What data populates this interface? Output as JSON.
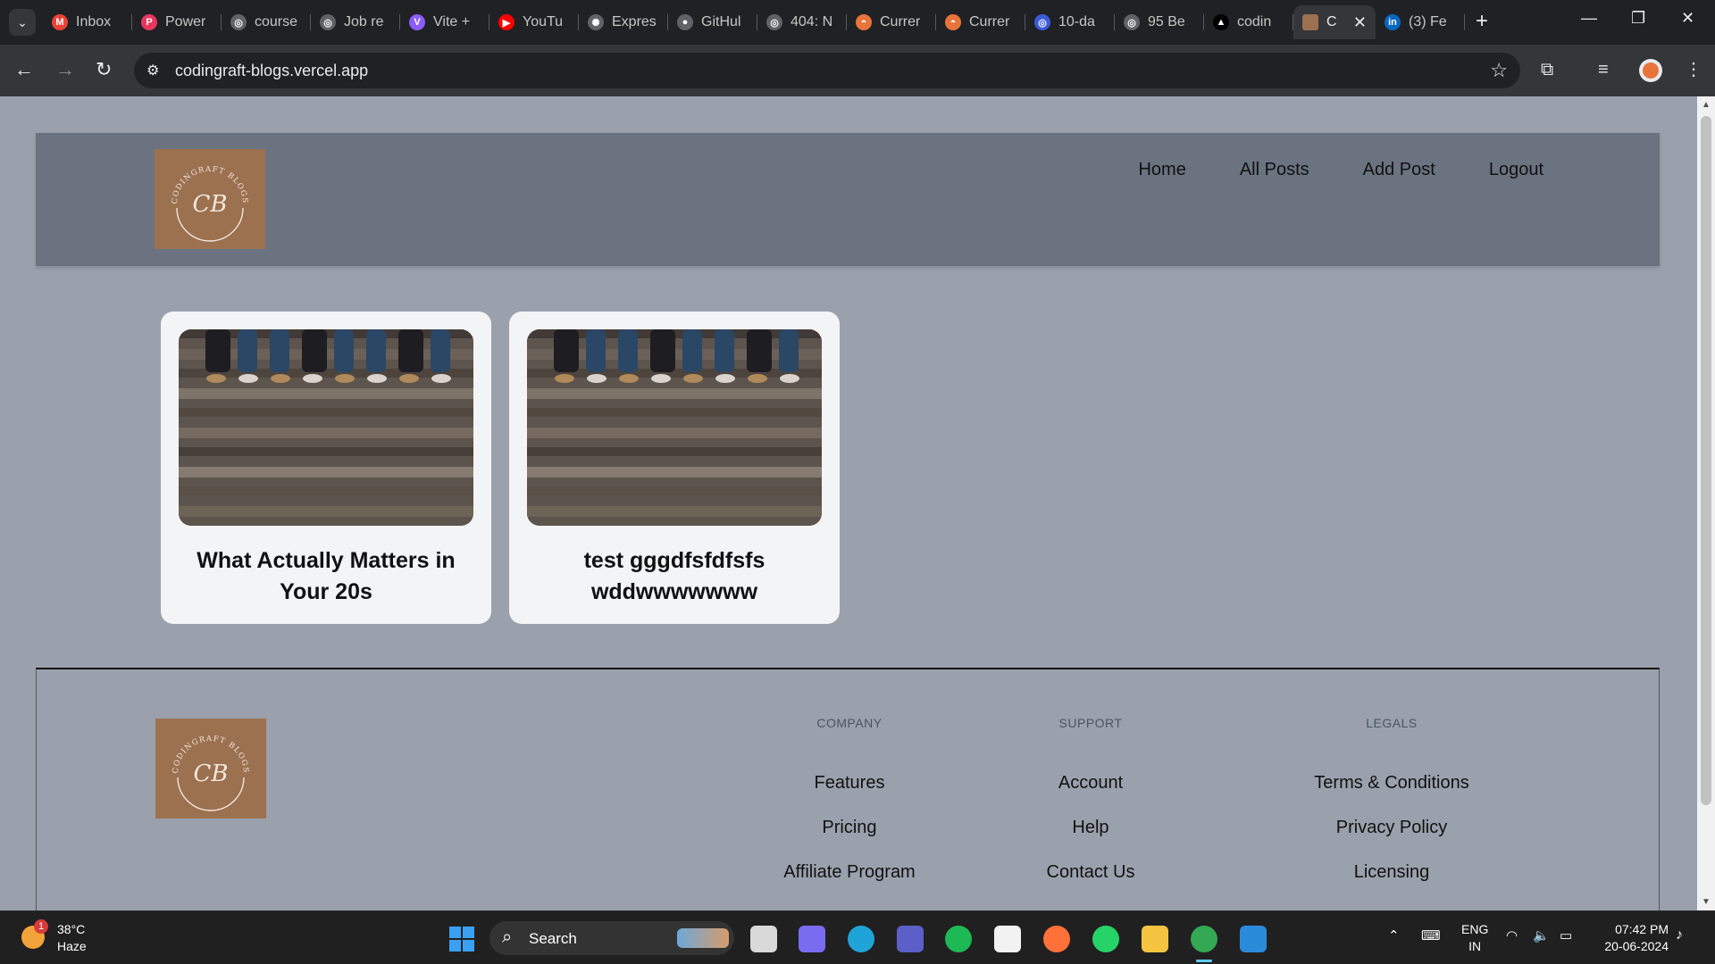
{
  "browser": {
    "tabs": [
      {
        "title": "Inbox",
        "icon": "gmail-icon",
        "color": "#ea4335",
        "glyph": "M"
      },
      {
        "title": "Power",
        "icon": "power-icon",
        "color": "#e8365d",
        "glyph": "P"
      },
      {
        "title": "course",
        "icon": "globe-icon",
        "color": "#5f6368",
        "glyph": "◎"
      },
      {
        "title": "Job re",
        "icon": "globe-icon",
        "color": "#5f6368",
        "glyph": "◎"
      },
      {
        "title": "Vite +",
        "icon": "vite-icon",
        "color": "#8b5cf6",
        "glyph": "V"
      },
      {
        "title": "YouTu",
        "icon": "youtube-icon",
        "color": "#ff0000",
        "glyph": "▶"
      },
      {
        "title": "Expres",
        "icon": "chatgpt-icon",
        "color": "#5f6368",
        "glyph": "✺"
      },
      {
        "title": "GitHul",
        "icon": "github-icon",
        "color": "#5f6368",
        "glyph": "●"
      },
      {
        "title": "404: N",
        "icon": "globe-icon",
        "color": "#5f6368",
        "glyph": "◎"
      },
      {
        "title": "Currer",
        "icon": "helmet-icon",
        "color": "#e8743b",
        "glyph": "◓"
      },
      {
        "title": "Currer",
        "icon": "helmet-icon",
        "color": "#e8743b",
        "glyph": "◓"
      },
      {
        "title": "10-da",
        "icon": "globe-icon",
        "color": "#3b5bdb",
        "glyph": "◎"
      },
      {
        "title": "95 Be",
        "icon": "globe-icon",
        "color": "#5f6368",
        "glyph": "◎"
      },
      {
        "title": "codin",
        "icon": "vercel-icon",
        "color": "#000000",
        "glyph": "▲"
      },
      {
        "title": "C",
        "icon": "codingraft-favicon",
        "color": "#9c7150",
        "glyph": "",
        "active": true
      },
      {
        "title": "(3) Fe",
        "icon": "linkedin-icon",
        "color": "#0a66c2",
        "glyph": "in"
      }
    ],
    "url": "codingraft-blogs.vercel.app"
  },
  "site": {
    "logo_text": "CODINGRAFT BLOGS",
    "logo_monogram": "CB",
    "nav": [
      "Home",
      "All Posts",
      "Add Post",
      "Logout"
    ],
    "posts": [
      {
        "title": "What Actually Matters in Your 20s"
      },
      {
        "title": "test gggdfsfdfsfs wddwwwwwww"
      }
    ],
    "footer": {
      "columns": [
        {
          "heading": "COMPANY",
          "links": [
            "Features",
            "Pricing",
            "Affiliate Program"
          ]
        },
        {
          "heading": "SUPPORT",
          "links": [
            "Account",
            "Help",
            "Contact Us"
          ]
        },
        {
          "heading": "LEGALS",
          "links": [
            "Terms & Conditions",
            "Privacy Policy",
            "Licensing"
          ]
        }
      ]
    }
  },
  "taskbar": {
    "weather": {
      "temp": "38°C",
      "condition": "Haze",
      "badge": "1"
    },
    "search_label": "Search",
    "lang_top": "ENG",
    "lang_bottom": "IN",
    "time": "07:42 PM",
    "date": "20-06-2024",
    "apps": [
      {
        "name": "task-view-icon",
        "color": "#d9d9d9"
      },
      {
        "name": "copilot-icon",
        "color": "#7a6cf0"
      },
      {
        "name": "edge-icon",
        "color": "#1fa4d8"
      },
      {
        "name": "teams-icon",
        "color": "#5b5fc7"
      },
      {
        "name": "spotify-icon",
        "color": "#1db954"
      },
      {
        "name": "ms-store-icon",
        "color": "#f2f2f2"
      },
      {
        "name": "firefox-icon",
        "color": "#ff7139"
      },
      {
        "name": "whatsapp-icon",
        "color": "#25d366"
      },
      {
        "name": "file-explorer-icon",
        "color": "#f5c542"
      },
      {
        "name": "chrome-icon",
        "color": "#34a853",
        "active": true
      },
      {
        "name": "vscode-icon",
        "color": "#2a8bdb"
      }
    ]
  }
}
